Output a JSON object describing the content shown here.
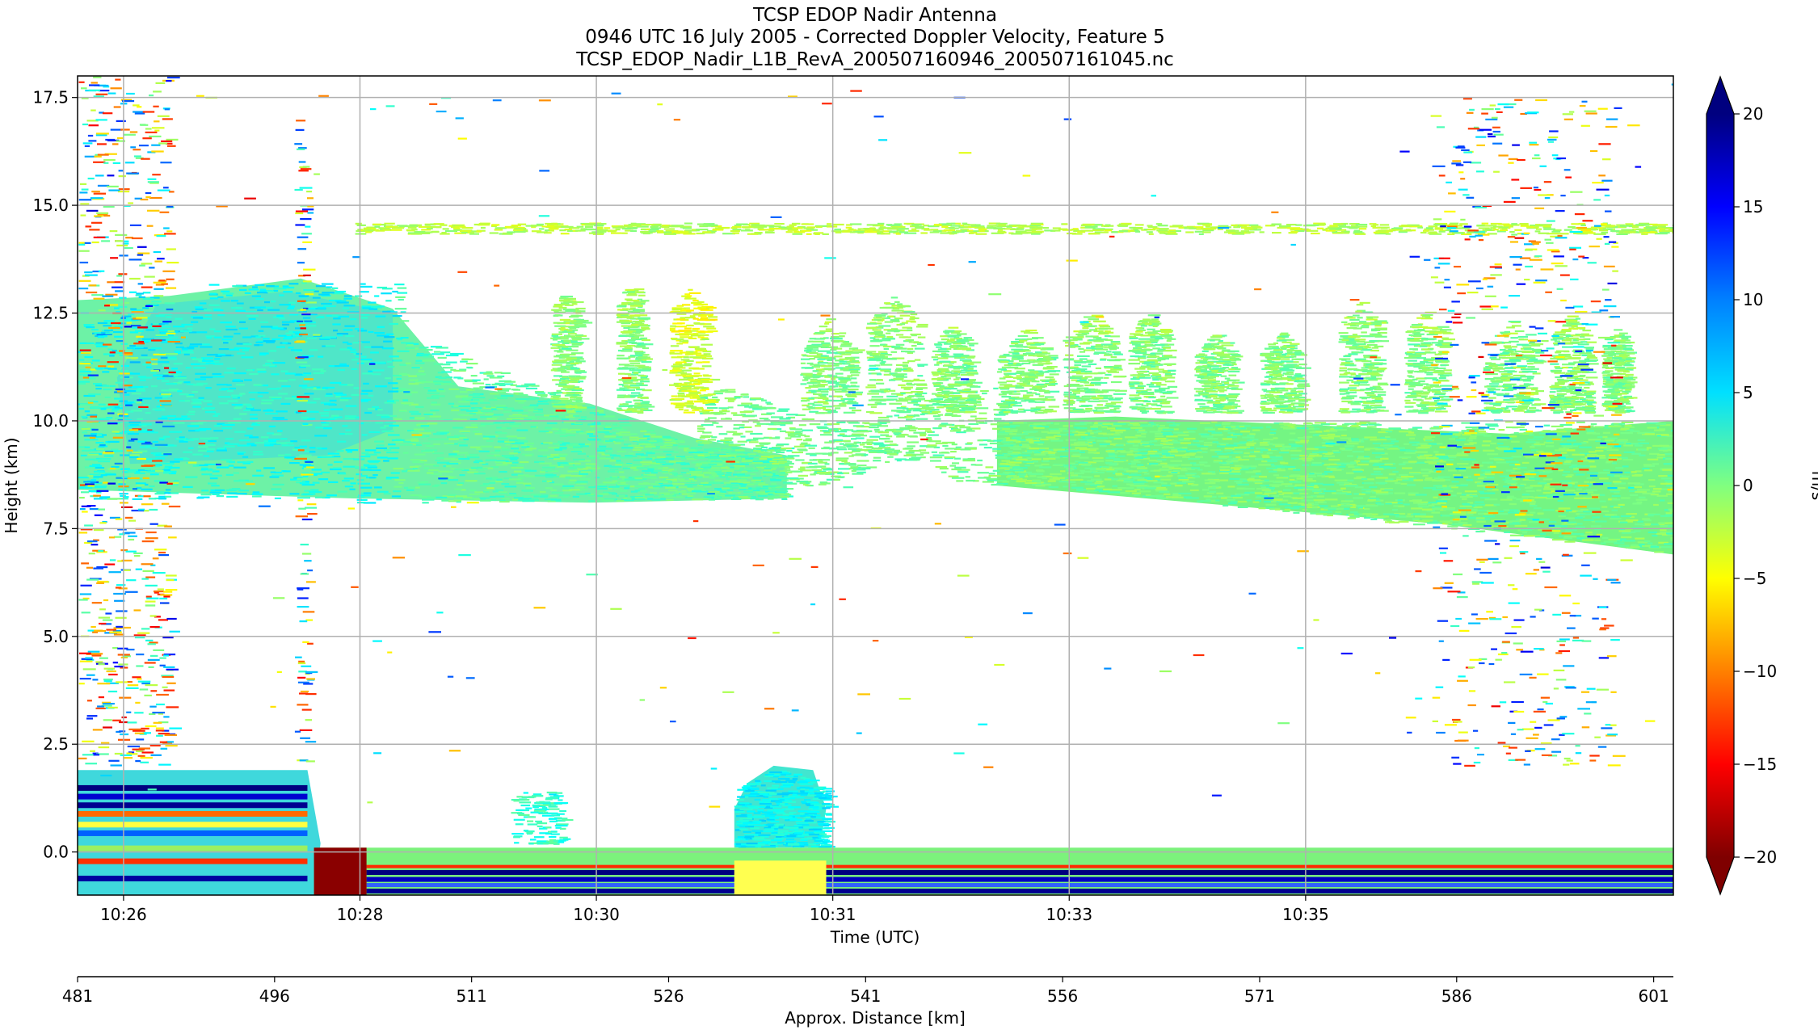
{
  "chart_data": {
    "type": "heatmap",
    "title_lines": [
      "TCSP EDOP Nadir Antenna",
      "0946 UTC 16 July 2005 - Corrected Doppler Velocity, Feature 5",
      "TCSP_EDOP_Nadir_L1B_RevA_200507160946_200507161045.nc"
    ],
    "xlabel": "Time (UTC)",
    "ylabel": "Height (km)",
    "x2label": "Approx. Distance [km]",
    "colorbar_label": "m/s",
    "x_ticks": [
      "10:26",
      "10:28",
      "10:30",
      "10:31",
      "10:33",
      "10:35"
    ],
    "x2_ticks": [
      "481",
      "496",
      "511",
      "526",
      "541",
      "556",
      "571",
      "586",
      "601"
    ],
    "y_ticks": [
      "0.0",
      "2.5",
      "5.0",
      "7.5",
      "10.0",
      "12.5",
      "15.0",
      "17.5"
    ],
    "ylim": [
      -1.0,
      18.0
    ],
    "x2lim": [
      481,
      602.5
    ],
    "colorbar_ticks": [
      "20",
      "15",
      "10",
      "5",
      "0",
      "−5",
      "−10",
      "−15",
      "−20"
    ],
    "colorbar_range": [
      -20,
      20
    ],
    "colormap": "jet_r",
    "grid": true,
    "extend": "both",
    "features": [
      {
        "name": "anvil cloud",
        "x_km_range": [
          481,
          554
        ],
        "height_km_range": [
          8.0,
          13.5
        ],
        "velocity_ms_approx": 3
      },
      {
        "name": "stratiform layer",
        "x_km_range": [
          554,
          602.5
        ],
        "height_km_range": [
          6.8,
          10.0
        ],
        "velocity_ms_approx": 0
      },
      {
        "name": "cloud turrets",
        "x_km_range": [
          516,
          598
        ],
        "height_km_range": [
          10.0,
          13.2
        ],
        "velocity_ms_approx": 0
      },
      {
        "name": "cirrus line",
        "x_km_range": [
          502,
          602.5
        ],
        "height_km_range": [
          14.3,
          14.6
        ],
        "velocity_ms_approx": -2
      },
      {
        "name": "low cumulus",
        "x_km_range": [
          531,
          538
        ],
        "height_km_range": [
          0.0,
          2.0
        ],
        "velocity_ms_approx": 5
      },
      {
        "name": "surface echo",
        "x_km_range": [
          481,
          602.5
        ],
        "height_km_range": [
          -1.0,
          0.1
        ],
        "velocity_ms_approx": "mixed"
      }
    ]
  }
}
